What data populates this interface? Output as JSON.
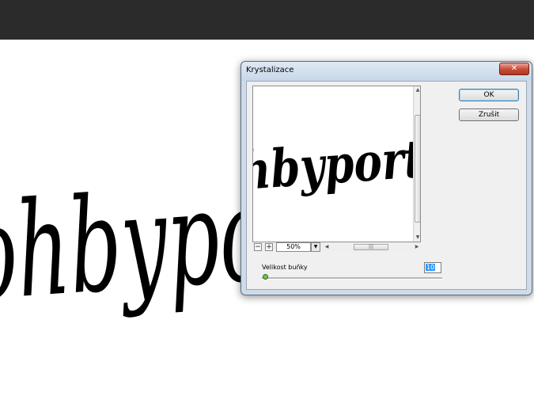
{
  "dialog": {
    "title": "Krystalizace",
    "close_glyph": "✕",
    "ok_label": "OK",
    "cancel_label": "Zrušit",
    "preview": {
      "text": "hbyport",
      "zoom_minus": "−",
      "zoom_plus": "+",
      "zoom_value": "50%",
      "zoom_dropdown_glyph": "▼",
      "scroll_grip": "|||"
    },
    "parameter": {
      "label": "Velikost buňky",
      "value": "10"
    }
  },
  "canvas": {
    "text": "ohbypo"
  },
  "icons": {
    "close": "close-icon",
    "dropdown": "chevron-down-icon",
    "zoom_in": "plus-icon",
    "zoom_out": "minus-icon"
  }
}
